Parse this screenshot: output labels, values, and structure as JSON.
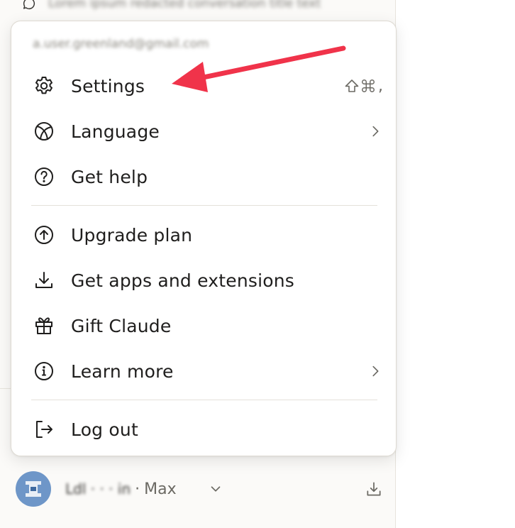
{
  "recent_chat": {
    "icon": "chat-bubble-icon",
    "title_redacted": "Lorem ipsum redacted conversation title text"
  },
  "menu": {
    "email_redacted": "a.user.greenland@gmail.com",
    "items": [
      {
        "label": "Settings",
        "icon": "gear-icon",
        "shortcut": "⇧⌘,"
      },
      {
        "label": "Language",
        "icon": "globe-icon",
        "submenu": true
      },
      {
        "label": "Get help",
        "icon": "help-circle-icon"
      },
      {
        "label": "Upgrade plan",
        "icon": "arrow-up-circle-icon"
      },
      {
        "label": "Get apps and extensions",
        "icon": "download-icon"
      },
      {
        "label": "Gift Claude",
        "icon": "gift-icon"
      },
      {
        "label": "Learn more",
        "icon": "info-circle-icon",
        "submenu": true
      },
      {
        "label": "Log out",
        "icon": "logout-icon"
      }
    ]
  },
  "user": {
    "name_redacted": "Ldl · · · in",
    "separator": "·",
    "plan": "Max"
  },
  "colors": {
    "annotation_arrow": "#f0334a",
    "avatar": "#6e96c8"
  }
}
